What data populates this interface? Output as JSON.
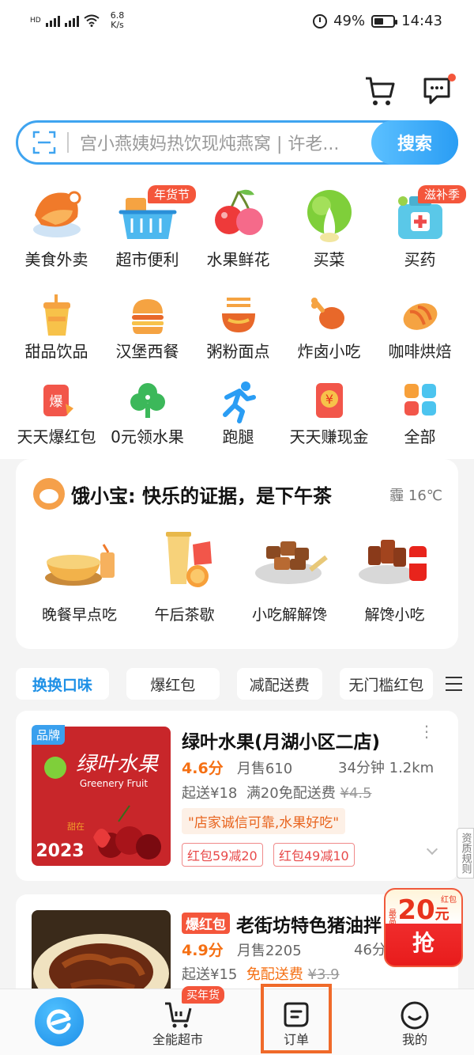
{
  "status_bar": {
    "net_speed": "6.8",
    "net_unit": "K/s",
    "battery": "49%",
    "time": "14:43",
    "battery_level": 0.49
  },
  "header": {
    "cart_icon": "cart-icon",
    "message_icon": "message-icon"
  },
  "search": {
    "placeholder": "宫小燕姨妈热饮现炖燕窝 | 许老...",
    "button": "搜索"
  },
  "categories": [
    {
      "label": "美食外卖",
      "icon": "food-icon"
    },
    {
      "label": "超市便利",
      "icon": "basket-icon",
      "tag": "年货节"
    },
    {
      "label": "水果鲜花",
      "icon": "cherry-icon"
    },
    {
      "label": "买菜",
      "icon": "vegetable-icon"
    },
    {
      "label": "买药",
      "icon": "medicine-icon",
      "tag": "滋补季"
    },
    {
      "label": "甜品饮品",
      "icon": "drink-icon"
    },
    {
      "label": "汉堡西餐",
      "icon": "burger-icon"
    },
    {
      "label": "粥粉面点",
      "icon": "noodle-icon"
    },
    {
      "label": "炸卤小吃",
      "icon": "drumstick-icon"
    },
    {
      "label": "咖啡烘焙",
      "icon": "bread-icon"
    },
    {
      "label": "天天爆红包",
      "icon": "redpacket-icon",
      "glyph": "爆"
    },
    {
      "label": "0元领水果",
      "icon": "tree-icon"
    },
    {
      "label": "跑腿",
      "icon": "runner-icon"
    },
    {
      "label": "天天赚现金",
      "icon": "cash-icon",
      "glyph": "¥"
    },
    {
      "label": "全部",
      "icon": "all-grid-icon"
    }
  ],
  "promo": {
    "title": "饿小宝: 快乐的证据，是下午茶",
    "weather": "霾 16℃",
    "items": [
      {
        "label": "晚餐早点吃"
      },
      {
        "label": "午后茶歇"
      },
      {
        "label": "小吃解解馋"
      },
      {
        "label": "解馋小吃"
      }
    ]
  },
  "filters": {
    "items": [
      "换换口味",
      "爆红包",
      "减配送费",
      "无门槛红包"
    ]
  },
  "stores": [
    {
      "badge": "品牌",
      "name": "绿叶水果(月湖小区二店)",
      "rating": "4.6分",
      "sales": "月售610",
      "eta": "34分钟 1.2km",
      "min_order": "起送¥18",
      "delivery": "满20免配送费",
      "old_fee": "¥4.5",
      "quote": "\"店家诚信可靠,水果好吃\"",
      "coupons": [
        "红包59减20",
        "红包49减10"
      ],
      "logo_cn": "绿叶水果",
      "logo_en": "Greenery Fruit",
      "year_small": "甜在",
      "year": "2023"
    },
    {
      "badge": "爆红包",
      "name": "老街坊特色猪油拌",
      "rating": "4.9分",
      "sales": "月售2205",
      "eta": "46分钟",
      "min_order": "起送¥15",
      "delivery": "免配送费",
      "old_fee": "¥3.9"
    }
  ],
  "side_tab": "资质规则",
  "float_coupon": {
    "label": "红包",
    "max": "最高",
    "amount": "20",
    "unit": "元",
    "action": "抢"
  },
  "tabbar": {
    "items": [
      "全能超市",
      "订单",
      "我的"
    ],
    "badge": "买年货"
  },
  "colors": {
    "accent": "#2a9df4",
    "orange": "#f57014",
    "red": "#f4563b"
  }
}
